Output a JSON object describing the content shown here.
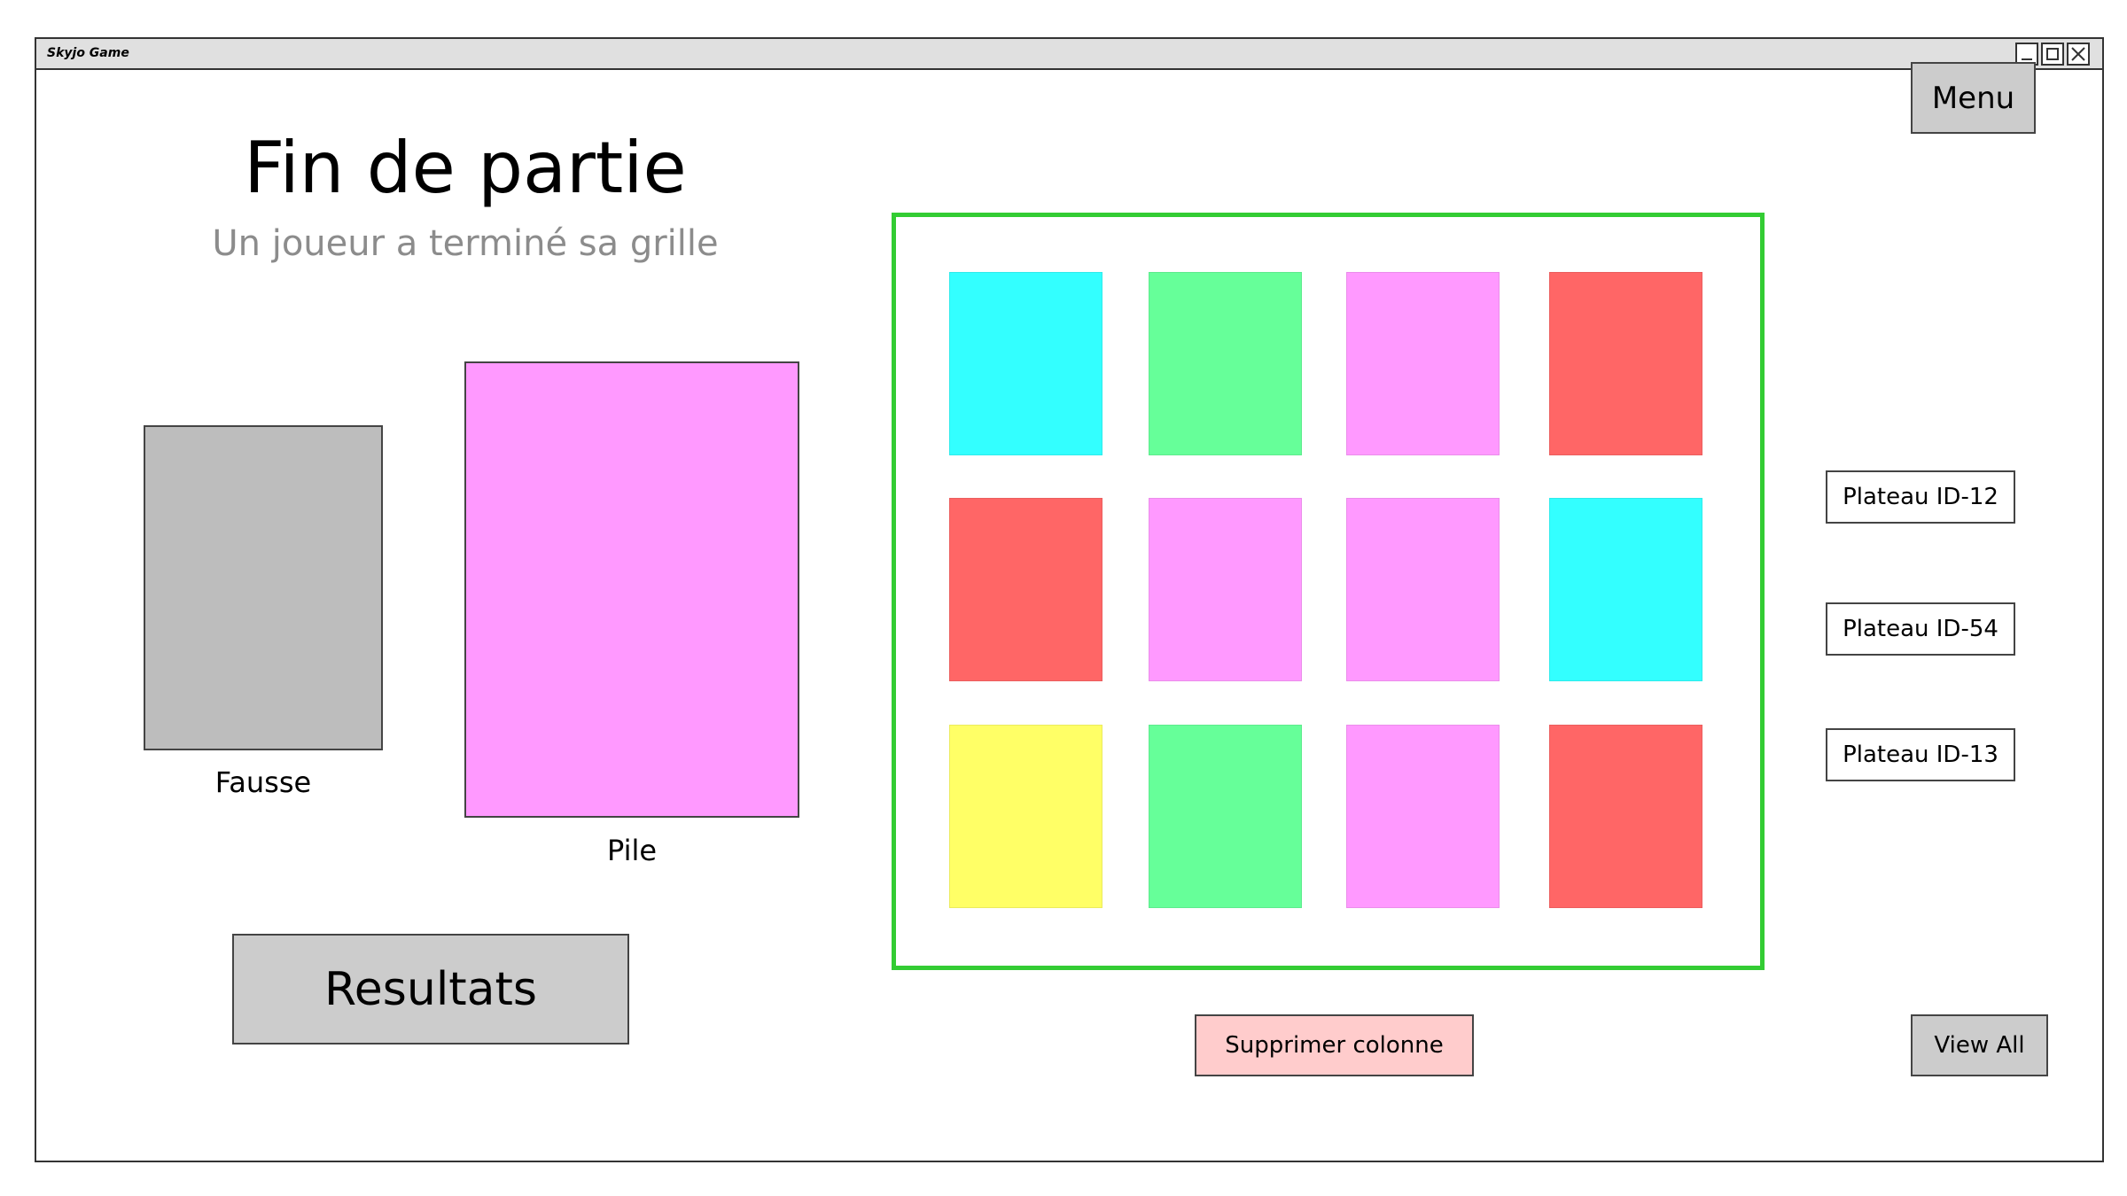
{
  "window": {
    "title": "Skyjo Game",
    "controls": [
      "minimize-icon",
      "maximize-icon",
      "close-icon"
    ]
  },
  "header": {
    "menu_label": "Menu",
    "title": "Fin de partie",
    "subtitle": "Un joueur a terminé sa grille"
  },
  "piles": {
    "discard": {
      "label": "Fausse",
      "color": "#bdbdbd"
    },
    "draw": {
      "label": "Pile",
      "color": "#ff99ff"
    }
  },
  "actions": {
    "results_label": "Resultats",
    "delete_column_label": "Supprimer colonne",
    "view_all_label": "View All"
  },
  "board": {
    "border_color": "#33cc33",
    "cards": [
      {
        "color": "#33ffff"
      },
      {
        "color": "#66ff99"
      },
      {
        "color": "#ff99ff"
      },
      {
        "color": "#ff6666"
      },
      {
        "color": "#ff6666"
      },
      {
        "color": "#ff99ff"
      },
      {
        "color": "#ff99ff"
      },
      {
        "color": "#33ffff"
      },
      {
        "color": "#ffff66"
      },
      {
        "color": "#66ff99"
      },
      {
        "color": "#ff99ff"
      },
      {
        "color": "#ff6666"
      }
    ]
  },
  "other_boards": [
    {
      "label": "Plateau ID-12"
    },
    {
      "label": "Plateau ID-54"
    },
    {
      "label": "Plateau ID-13"
    }
  ]
}
